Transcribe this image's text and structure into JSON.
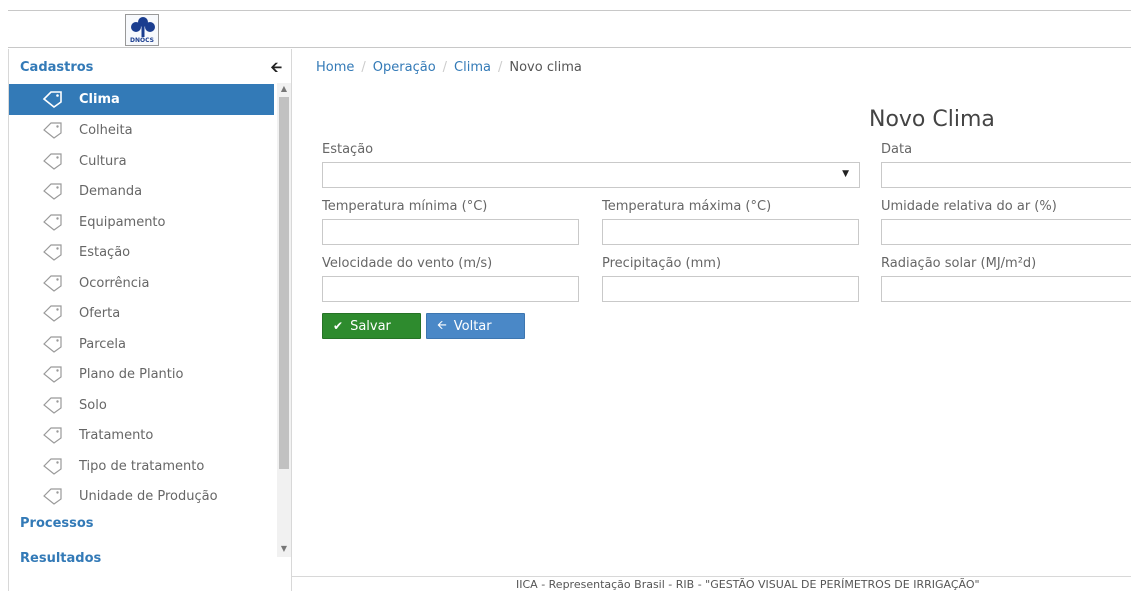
{
  "header": {
    "logo_text": "DNOCS",
    "colors": {
      "logo_blue": "#1a3d8f"
    }
  },
  "sidebar": {
    "sections": {
      "cadastros": "Cadastros",
      "processos": "Processos",
      "resultados": "Resultados"
    },
    "collapse_icon": "arrow-left-icon",
    "items": [
      {
        "label": "Clima",
        "active": true
      },
      {
        "label": "Colheita"
      },
      {
        "label": "Cultura"
      },
      {
        "label": "Demanda"
      },
      {
        "label": "Equipamento"
      },
      {
        "label": "Estação"
      },
      {
        "label": "Ocorrência"
      },
      {
        "label": "Oferta"
      },
      {
        "label": "Parcela"
      },
      {
        "label": "Plano de Plantio"
      },
      {
        "label": "Solo"
      },
      {
        "label": "Tratamento"
      },
      {
        "label": "Tipo de tratamento"
      },
      {
        "label": "Unidade de Produção"
      }
    ],
    "colors": {
      "accent": "#337ab7"
    }
  },
  "breadcrumb": {
    "home": "Home",
    "operacao": "Operação",
    "clima": "Clima",
    "current": "Novo clima"
  },
  "form": {
    "title": "Novo Clima",
    "fields": {
      "estacao": {
        "label": "Estação",
        "value": ""
      },
      "data": {
        "label": "Data",
        "value": ""
      },
      "temp_min": {
        "label": "Temperatura mínima (°C)",
        "value": ""
      },
      "temp_max": {
        "label": "Temperatura máxima (°C)",
        "value": ""
      },
      "umidade": {
        "label": "Umidade relativa do ar (%)",
        "value": ""
      },
      "vento": {
        "label": "Velocidade do vento (m/s)",
        "value": ""
      },
      "precipitacao": {
        "label": "Precipitação (mm)",
        "value": ""
      },
      "radiacao": {
        "label": "Radiação solar (MJ/m²d)",
        "value": ""
      }
    },
    "buttons": {
      "save": "Salvar",
      "back": "Voltar"
    },
    "colors": {
      "save": "#2e8b2e",
      "back": "#4a88c7"
    }
  },
  "footer": {
    "text": "IICA - Representação Brasil - RIB - \"GESTÃO VISUAL DE PERÍMETROS DE IRRIGAÇÃO\""
  }
}
